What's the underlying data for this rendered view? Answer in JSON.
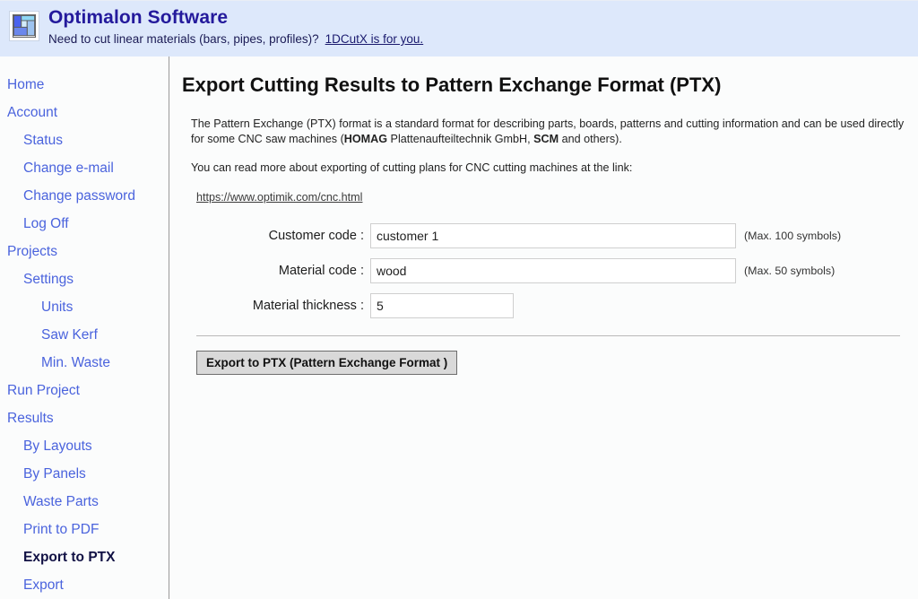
{
  "header": {
    "logo_icon": "grid-blocks-logo-icon",
    "brand_title": "Optimalon Software",
    "tagline": "Need to cut linear materials (bars, pipes, profiles)?",
    "tagline_link": "1DCutX is for you."
  },
  "sidebar": {
    "items": [
      {
        "label": "Home",
        "level": 0,
        "active": false
      },
      {
        "label": "Account",
        "level": 0,
        "active": false
      },
      {
        "label": "Status",
        "level": 1,
        "active": false
      },
      {
        "label": "Change e-mail",
        "level": 1,
        "active": false
      },
      {
        "label": "Change password",
        "level": 1,
        "active": false
      },
      {
        "label": "Log Off",
        "level": 1,
        "active": false
      },
      {
        "label": "Projects",
        "level": 0,
        "active": false
      },
      {
        "label": "Settings",
        "level": 1,
        "active": false
      },
      {
        "label": "Units",
        "level": 2,
        "active": false
      },
      {
        "label": "Saw Kerf",
        "level": 2,
        "active": false
      },
      {
        "label": "Min. Waste",
        "level": 2,
        "active": false
      },
      {
        "label": "Run Project",
        "level": 0,
        "active": false
      },
      {
        "label": "Results",
        "level": 0,
        "active": false
      },
      {
        "label": "By Layouts",
        "level": 1,
        "active": false
      },
      {
        "label": "By Panels",
        "level": 1,
        "active": false
      },
      {
        "label": "Waste Parts",
        "level": 1,
        "active": false
      },
      {
        "label": "Print to PDF",
        "level": 1,
        "active": false
      },
      {
        "label": "Export to PTX",
        "level": 1,
        "active": true
      },
      {
        "label": "Export",
        "level": 1,
        "active": false
      }
    ]
  },
  "main": {
    "page_title": "Export Cutting Results to Pattern Exchange Format (PTX)",
    "intro_part1": "The Pattern Exchange (PTX) format is a standard format for describing parts, boards, patterns and cutting information and can be used directly for some CNC saw machines (",
    "intro_bold1": "HOMAG",
    "intro_part2": " Plattenaufteiltechnik GmbH, ",
    "intro_bold2": "SCM",
    "intro_part3": " and others).",
    "read_more": "You can read more about exporting of cutting plans for CNC cutting machines at the link:",
    "link_text": "https://www.optimik.com/cnc.html",
    "form": {
      "fields": [
        {
          "label": "Customer code :",
          "value": "customer 1",
          "hint": "(Max. 100 symbols)"
        },
        {
          "label": "Material code :",
          "value": "wood",
          "hint": "(Max. 50 symbols)"
        },
        {
          "label": "Material thickness :",
          "value": "5",
          "hint": ""
        }
      ],
      "submit_label": "Export to PTX (Pattern Exchange Format )"
    }
  },
  "colors": {
    "header_bg": "#dde8fb",
    "brand_title": "#241a9c",
    "nav_link": "#4a63dd",
    "nav_active": "#111144",
    "button_bg": "#d9d9d9",
    "page_bg": "#fbfcfc"
  }
}
